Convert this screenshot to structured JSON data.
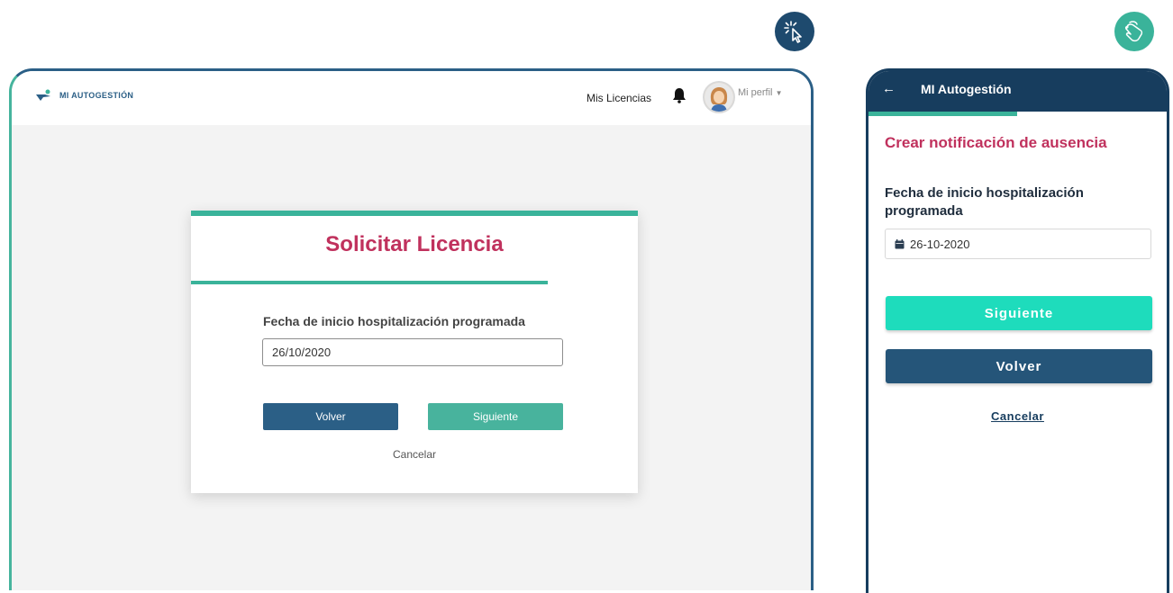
{
  "badges": {
    "desktop_icon": "click-cursor-icon",
    "mobile_icon": "tap-hand-icon"
  },
  "desktop": {
    "logo_text": "MI AUTOGESTIÓN",
    "nav_licencias": "Mis Licencias",
    "profile_label": "Mi perfil",
    "card": {
      "title": "Solicitar Licencia",
      "field_label": "Fecha de inicio hospitalización programada",
      "date_value": "26/10/2020",
      "volver_label": "Volver",
      "siguiente_label": "Siguiente",
      "cancel_label": "Cancelar"
    }
  },
  "mobile": {
    "header_title": "MI Autogestión",
    "heading": "Crear notificación de ausencia",
    "field_label": "Fecha de inicio hospitalización programada",
    "date_value": "26-10-2020",
    "siguiente_label": "Siguiente",
    "volver_label": "Volver",
    "cancel_label": "Cancelar"
  },
  "colors": {
    "navy": "#1e4a6e",
    "teal": "#3ab39a",
    "crimson": "#c0315d",
    "mint": "#1edcbc"
  }
}
